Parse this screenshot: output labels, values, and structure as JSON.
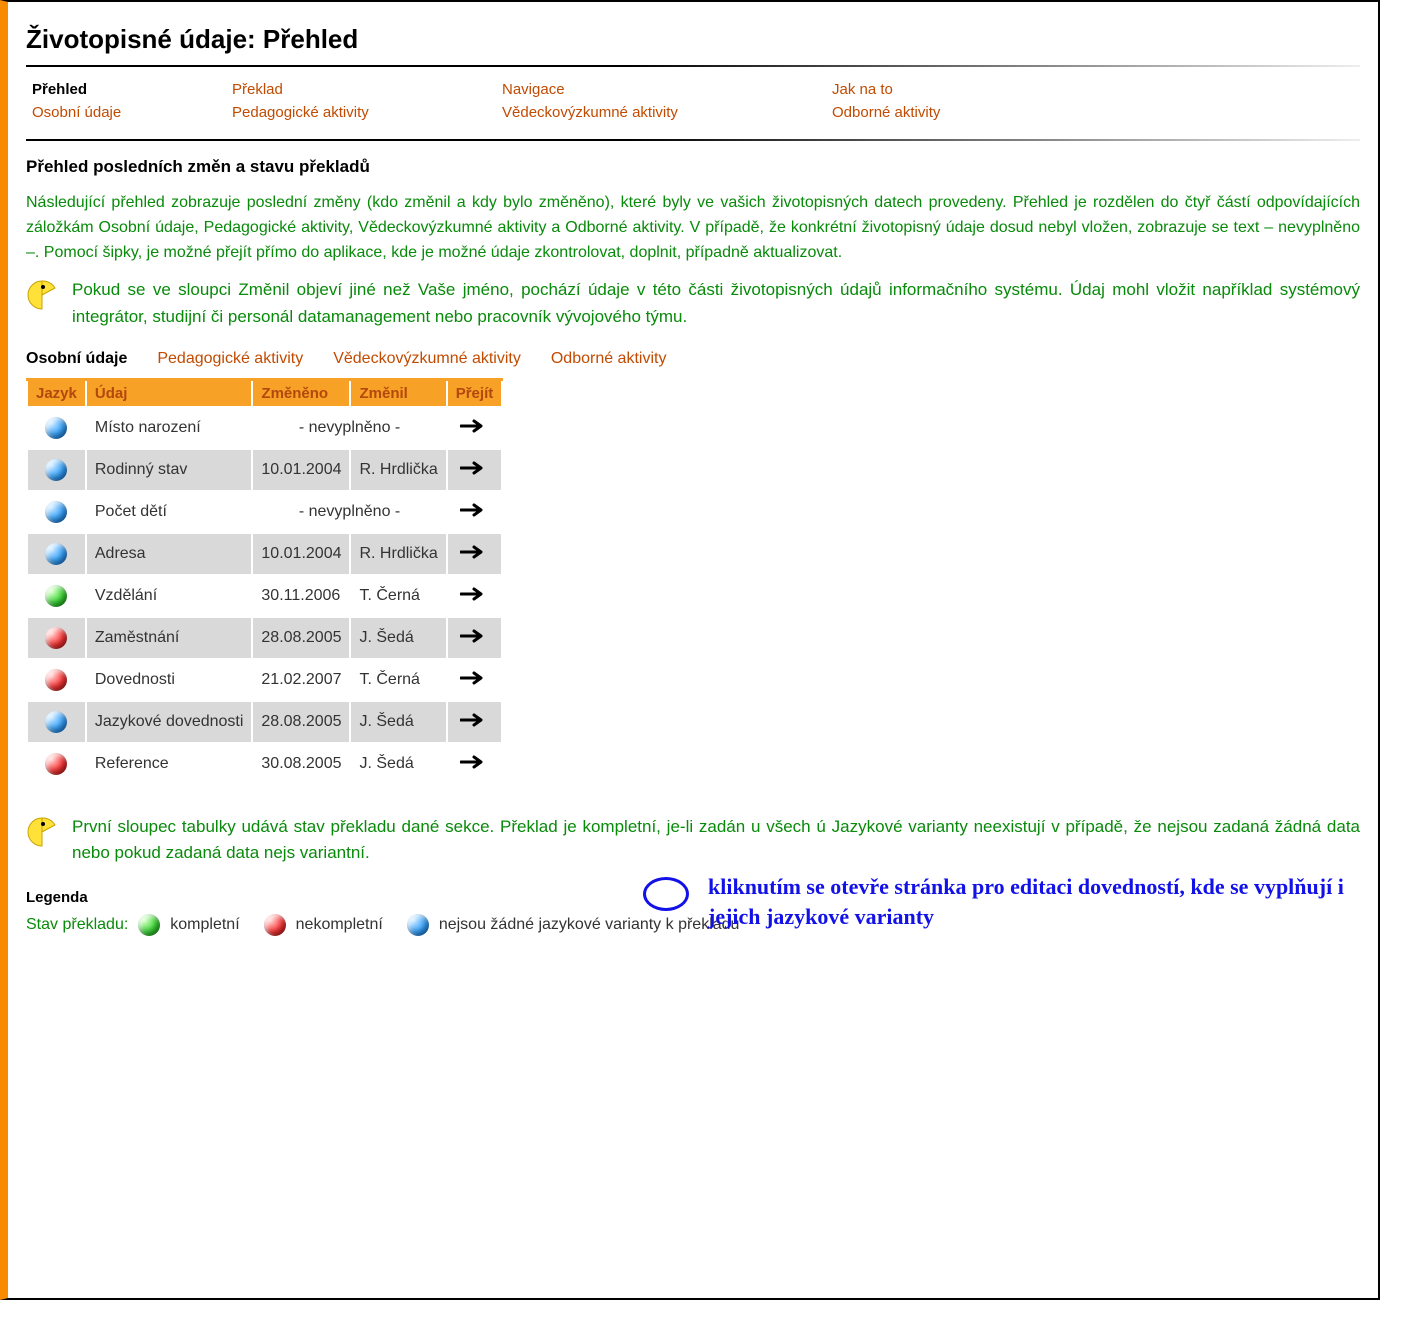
{
  "page_title": "Životopisné údaje: Přehled",
  "nav": {
    "rows": [
      [
        {
          "label": "Přehled",
          "active": true
        },
        {
          "label": "Překlad"
        },
        {
          "label": "Navigace"
        },
        {
          "label": "Jak na to"
        }
      ],
      [
        {
          "label": "Osobní údaje"
        },
        {
          "label": "Pedagogické aktivity"
        },
        {
          "label": "Vědeckovýzkumné aktivity"
        },
        {
          "label": "Odborné aktivity"
        }
      ]
    ]
  },
  "section_title": "Přehled posledních změn a stavu překladů",
  "intro": "Následující přehled zobrazuje poslední změny (kdo změnil a kdy bylo změněno), které byly ve vašich životopisných datech provedeny. Přehled je rozdělen do čtyř částí odpovídajících záložkám Osobní údaje, Pedagogické aktivity, Vědeckovýzkumné aktivity a Odborné aktivity. V případě, že konkrétní životopisný údaje dosud nebyl vložen, zobrazuje se text – nevyplněno –. Pomocí šipky, je možné přejít přímo do aplikace, kde je možné údaje zkontrolovat, doplnit, případně aktualizovat.",
  "tip1": "Pokud se ve sloupci Změnil objeví jiné než Vaše jméno, pochází údaje v této části životopisných údajů informačního systému. Údaj mohl vložit například systémový integrátor, studijní či personál datamanagement nebo pracovník vývojového týmu.",
  "sub_tabs": [
    {
      "label": "Osobní údaje",
      "active": true
    },
    {
      "label": "Pedagogické aktivity"
    },
    {
      "label": "Vědeckovýzkumné aktivity"
    },
    {
      "label": "Odborné aktivity"
    }
  ],
  "table": {
    "headers": [
      "Jazyk",
      "Údaj",
      "Změněno",
      "Změnil",
      "Přejít"
    ],
    "rows": [
      {
        "lang": "blue",
        "udaj": "Místo narození",
        "zmeneno": "",
        "zmenil": "",
        "nevyplneno": true
      },
      {
        "lang": "blue",
        "udaj": "Rodinný stav",
        "zmeneno": "10.01.2004",
        "zmenil": "R. Hrdlička",
        "alt": true
      },
      {
        "lang": "blue",
        "udaj": "Počet dětí",
        "zmeneno": "",
        "zmenil": "",
        "nevyplneno": true
      },
      {
        "lang": "blue",
        "udaj": "Adresa",
        "zmeneno": "10.01.2004",
        "zmenil": "R. Hrdlička",
        "alt": true
      },
      {
        "lang": "green",
        "udaj": "Vzdělání",
        "zmeneno": "30.11.2006",
        "zmenil": "T. Černá"
      },
      {
        "lang": "red",
        "udaj": "Zaměstnání",
        "zmeneno": "28.08.2005",
        "zmenil": "J. Šedá",
        "alt": true
      },
      {
        "lang": "red",
        "udaj": "Dovednosti",
        "zmeneno": "21.02.2007",
        "zmenil": "T. Černá"
      },
      {
        "lang": "blue",
        "udaj": "Jazykové dovednosti",
        "zmeneno": "28.08.2005",
        "zmenil": "J. Šedá",
        "alt": true
      },
      {
        "lang": "red",
        "udaj": "Reference",
        "zmeneno": "30.08.2005",
        "zmenil": "J. Šedá"
      }
    ],
    "nevyplneno_text": "- nevyplněno -"
  },
  "annotation": "kliknutím se otevře stránka pro editaci dovedností, kde se vyplňují i jejich jazykové varianty",
  "tip2": "První sloupec tabulky udává stav překladu dané sekce. Překlad je kompletní, je-li zadán u všech ú Jazykové varianty neexistují v případě, že nejsou zadaná žádná data nebo pokud zadaná data nejs variantní.",
  "legend": {
    "title": "Legenda",
    "label": "Stav překladu:",
    "items": [
      {
        "color": "green",
        "text": "kompletní"
      },
      {
        "color": "red",
        "text": "nekompletní"
      },
      {
        "color": "blue",
        "text": "nejsou žádné jazykové varianty k překladu"
      }
    ]
  }
}
